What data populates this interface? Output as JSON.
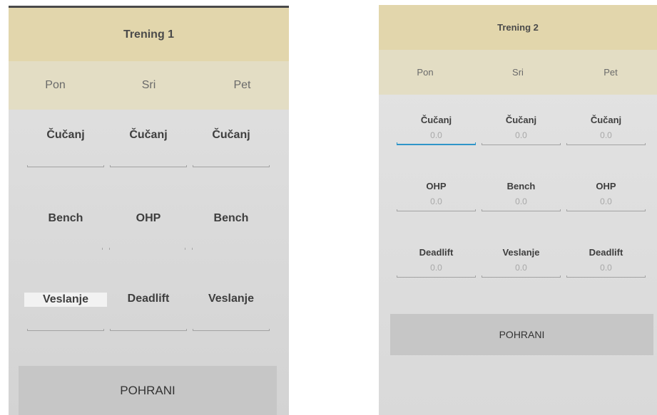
{
  "screen1": {
    "title": "Trening 1",
    "days": [
      "Pon",
      "Sri",
      "Pet"
    ],
    "rows": [
      [
        "Čučanj",
        "Čučanj",
        "Čučanj"
      ],
      [
        "Bench",
        "OHP",
        "Bench"
      ],
      [
        "Veslanje",
        "Deadlift",
        "Veslanje"
      ]
    ],
    "save_label": "POHRANI"
  },
  "screen2": {
    "title": "Trening 2",
    "days": [
      "Pon",
      "Sri",
      "Pet"
    ],
    "rows": [
      [
        "Čučanj",
        "Čučanj",
        "Čučanj"
      ],
      [
        "OHP",
        "Bench",
        "OHP"
      ],
      [
        "Deadlift",
        "Veslanje",
        "Deadlift"
      ]
    ],
    "values": [
      [
        "0.0",
        "0.0",
        "0.0"
      ],
      [
        "0.0",
        "0.0",
        "0.0"
      ],
      [
        "0.0",
        "0.0",
        "0.0"
      ]
    ],
    "save_label": "POHRANI"
  },
  "colors": {
    "title_bar": "#e2d6ac",
    "days_bar": "#e3ddc4",
    "focus_accent": "#2f95c9",
    "button_bg": "#c6c6c6"
  }
}
